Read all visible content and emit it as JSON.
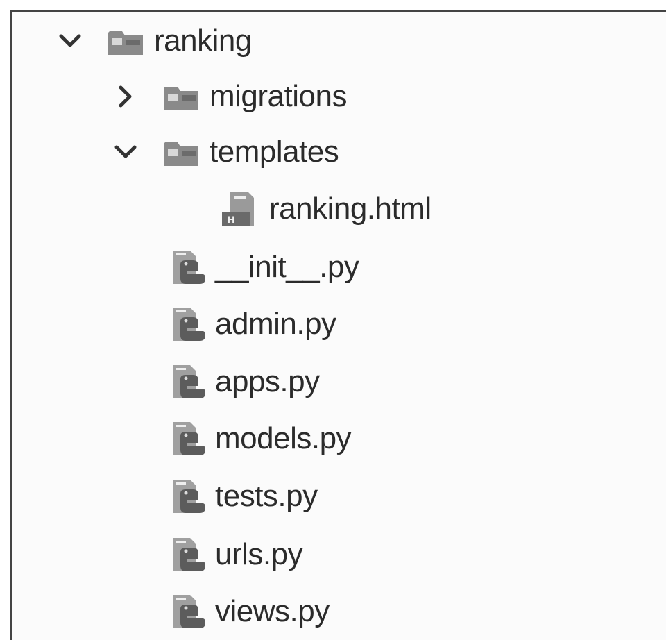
{
  "tree": {
    "root": {
      "label": "ranking",
      "expanded": true,
      "icon": "folder-icon"
    },
    "migrations": {
      "label": "migrations",
      "expanded": false,
      "icon": "folder-icon"
    },
    "templates": {
      "label": "templates",
      "expanded": true,
      "icon": "folder-icon"
    },
    "ranking_html": {
      "label": "ranking.html",
      "icon": "html-file-icon"
    },
    "files": [
      {
        "label": "__init__.py",
        "icon": "python-file-icon"
      },
      {
        "label": "admin.py",
        "icon": "python-file-icon"
      },
      {
        "label": "apps.py",
        "icon": "python-file-icon"
      },
      {
        "label": "models.py",
        "icon": "python-file-icon"
      },
      {
        "label": "tests.py",
        "icon": "python-file-icon"
      },
      {
        "label": "urls.py",
        "icon": "python-file-icon"
      },
      {
        "label": "views.py",
        "icon": "python-file-icon"
      }
    ]
  }
}
